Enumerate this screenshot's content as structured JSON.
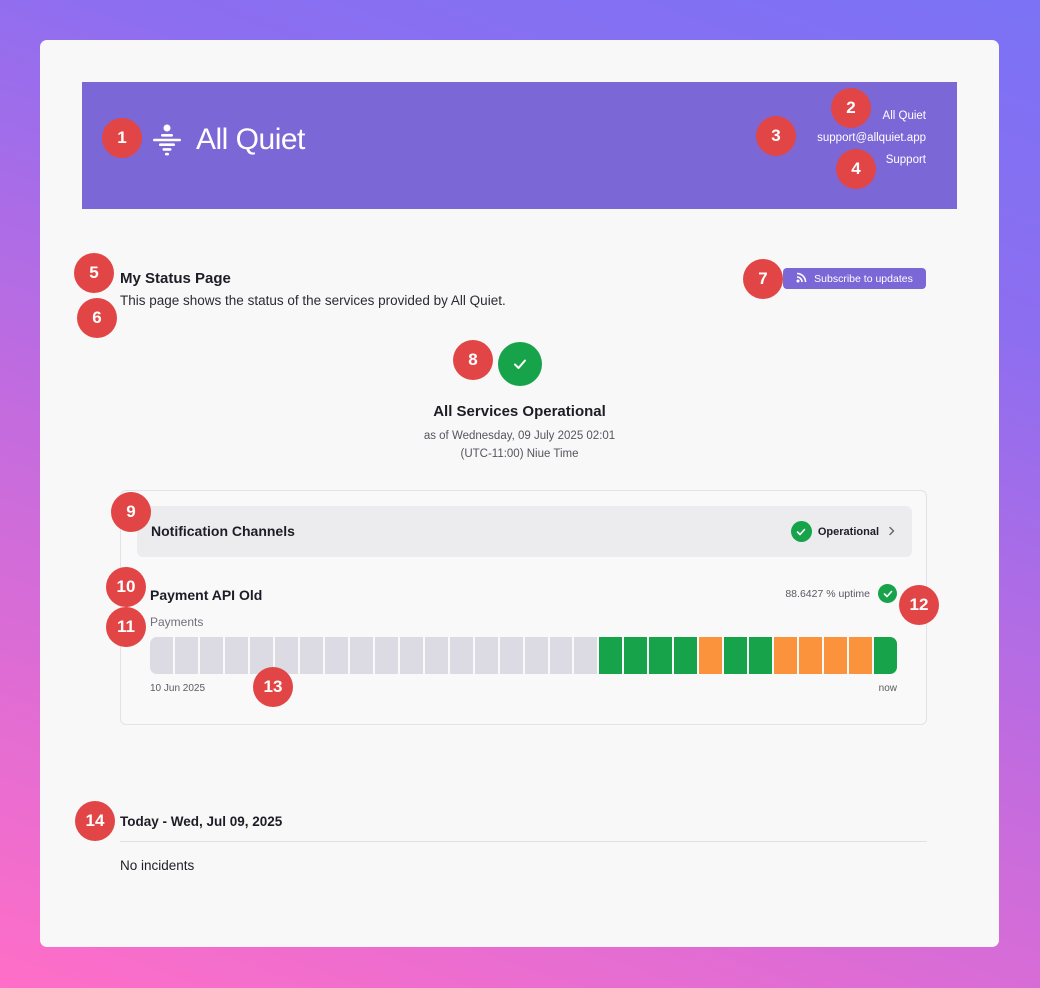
{
  "header": {
    "brand_name": "All Quiet",
    "link_company": "All Quiet",
    "link_email": "support@allquiet.app",
    "link_support": "Support"
  },
  "page": {
    "title": "My Status Page",
    "description": "This page shows the status of the services provided by All Quiet.",
    "subscribe_label": "Subscribe to updates"
  },
  "overall": {
    "title": "All Services Operational",
    "as_of": "as of Wednesday, 09 July 2025 02:01",
    "timezone": "(UTC-11:00) Niue Time"
  },
  "services": {
    "group": {
      "name": "Notification Channels",
      "status": "Operational"
    },
    "service": {
      "name": "Payment API Old",
      "description": "Payments",
      "uptime": "88.6427 % uptime",
      "range_start": "10 Jun 2025",
      "range_end": "now",
      "days": [
        "none",
        "none",
        "none",
        "none",
        "none",
        "none",
        "none",
        "none",
        "none",
        "none",
        "none",
        "none",
        "none",
        "none",
        "none",
        "none",
        "none",
        "none",
        "up",
        "up",
        "up",
        "up",
        "partial",
        "up",
        "up",
        "partial",
        "partial",
        "partial",
        "partial",
        "up"
      ]
    }
  },
  "incidents": {
    "day_title": "Today - Wed, Jul 09, 2025",
    "empty_text": "No incidents"
  },
  "markers": [
    "1",
    "2",
    "3",
    "4",
    "5",
    "6",
    "7",
    "8",
    "9",
    "10",
    "11",
    "12",
    "13",
    "14"
  ],
  "colors": {
    "brand": "#7b68d6",
    "operational": "#17a34a",
    "partial": "#fb923c",
    "no_data": "#dcdbe3",
    "marker": "#e24545"
  }
}
